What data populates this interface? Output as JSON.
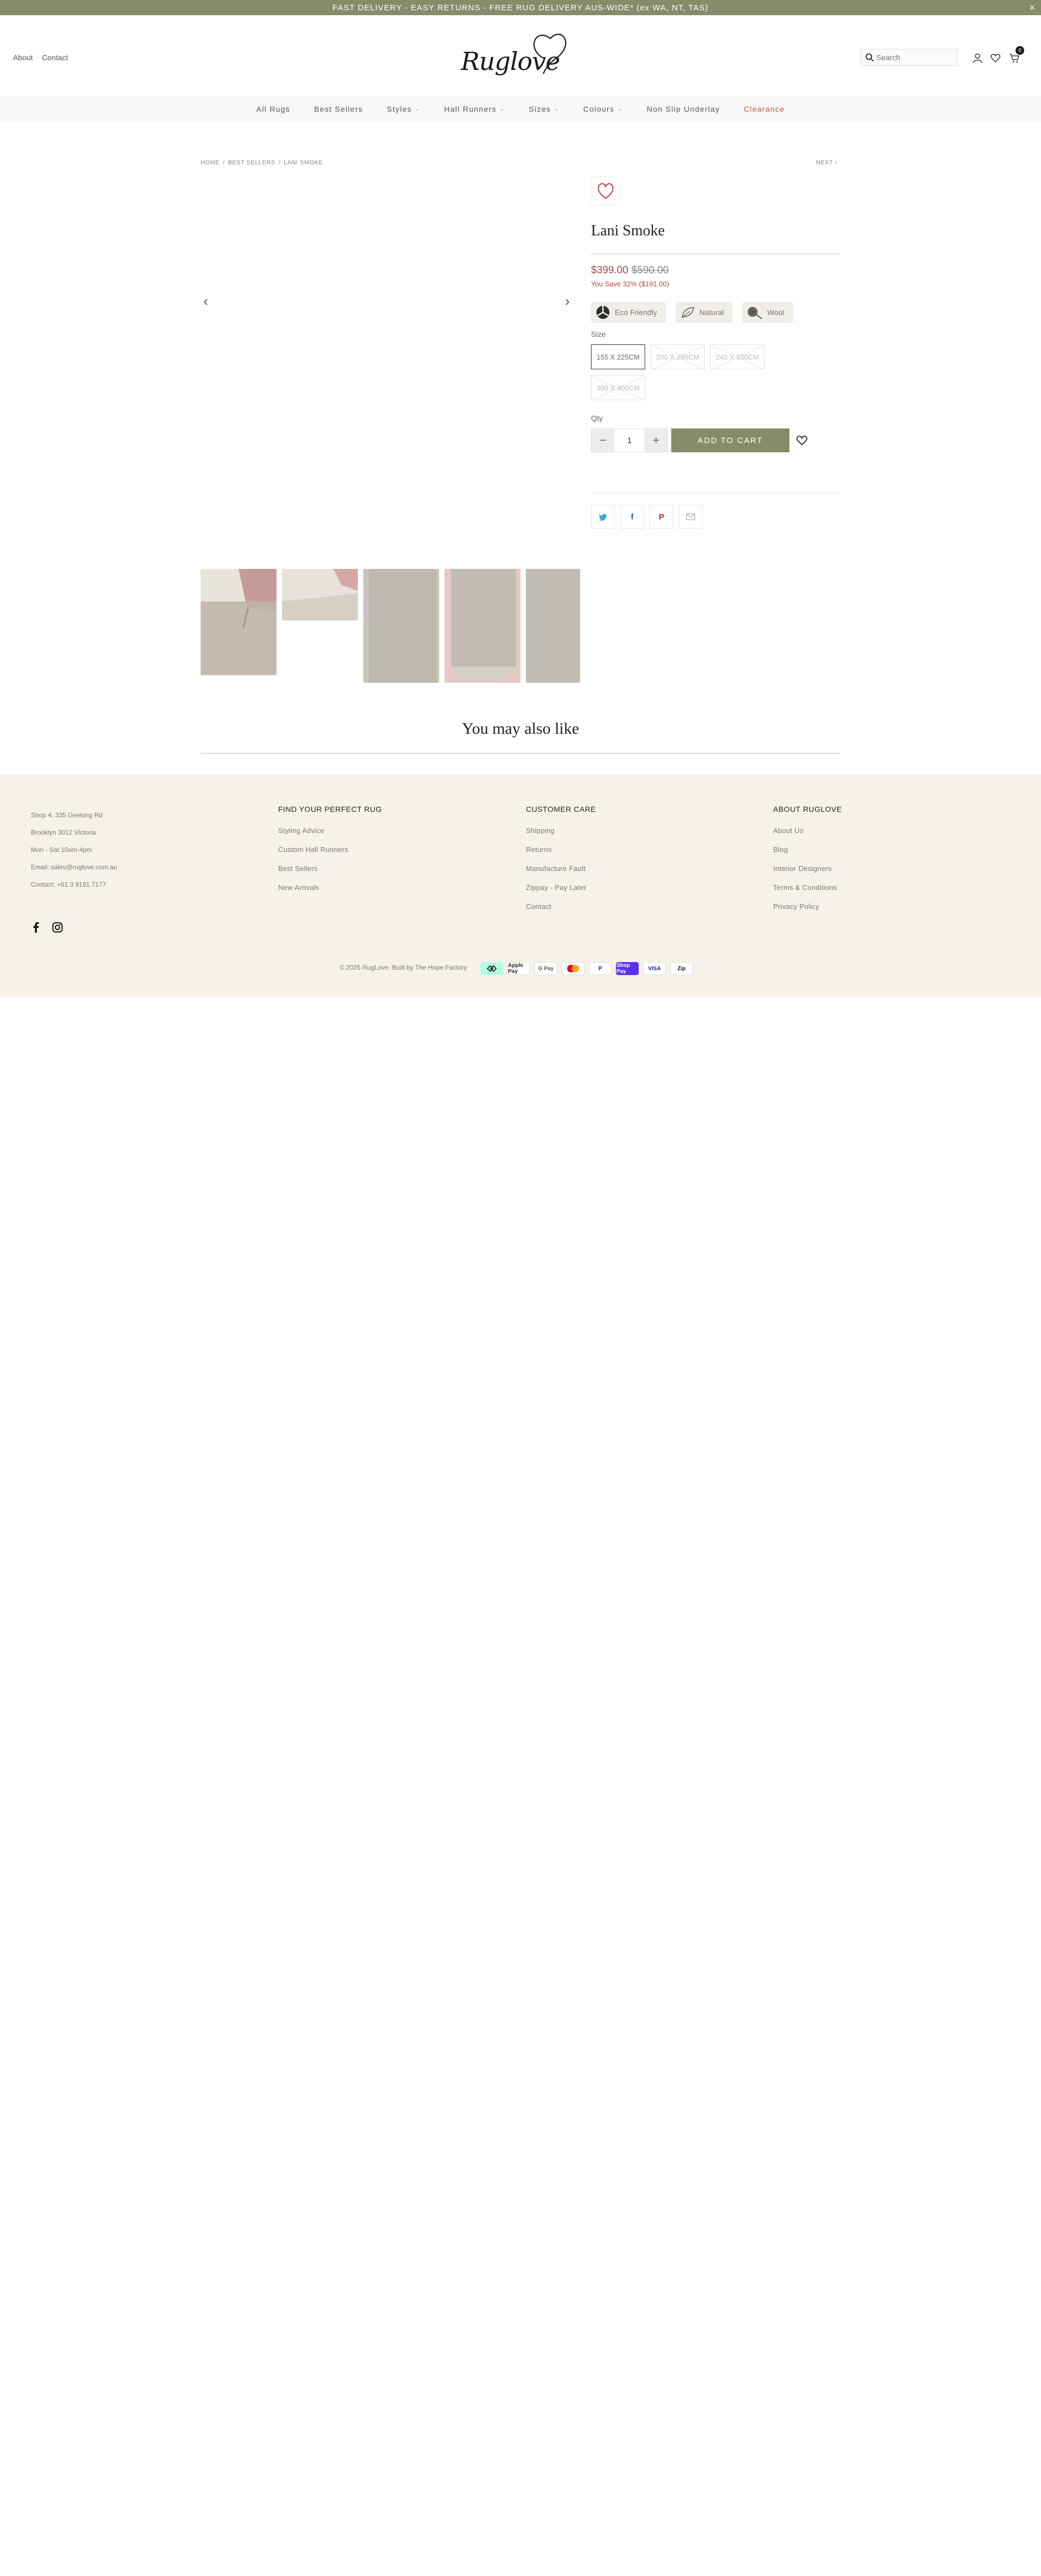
{
  "announcement": {
    "text": "FAST DELIVERY - EASY RETURNS - FREE RUG DELIVERY AUS-WIDE* (ex WA, NT, TAS)",
    "close": "×"
  },
  "header": {
    "links": [
      "About",
      "Contact"
    ],
    "logo_text": "Ruglove",
    "search_placeholder": "Search",
    "cart_count": "0"
  },
  "nav": {
    "items": [
      {
        "label": "All Rugs",
        "dropdown": false
      },
      {
        "label": "Best Sellers",
        "dropdown": false
      },
      {
        "label": "Styles",
        "dropdown": true
      },
      {
        "label": "Hall Runners",
        "dropdown": true
      },
      {
        "label": "Sizes",
        "dropdown": true
      },
      {
        "label": "Colours",
        "dropdown": true
      },
      {
        "label": "Non Slip Underlay",
        "dropdown": false
      },
      {
        "label": "Clearance",
        "dropdown": false
      }
    ]
  },
  "breadcrumb": {
    "items": [
      "HOME",
      "BEST SELLERS",
      "LANI SMOKE"
    ],
    "next": "NEXT"
  },
  "product": {
    "title": "Lani Smoke",
    "price": "$399.00",
    "was_price": "$590.00",
    "savings": "You Save 32% ($191.00)",
    "badges": [
      {
        "label": "Eco Friendly",
        "icon": "eco-icon"
      },
      {
        "label": "Natural",
        "icon": "leaf-icon"
      },
      {
        "label": "Wool",
        "icon": "wool-icon"
      }
    ],
    "size_label": "Size",
    "sizes": [
      {
        "label": "155 X 225CM",
        "available": true,
        "selected": true
      },
      {
        "label": "200 X 290CM",
        "available": false,
        "selected": false
      },
      {
        "label": "240 X 330CM",
        "available": false,
        "selected": false
      },
      {
        "label": "300 X 400CM",
        "available": false,
        "selected": false
      }
    ],
    "qty_label": "Qty",
    "qty_value": "1",
    "add_to_cart": "ADD TO CART"
  },
  "recommendations": {
    "title": "You may also like"
  },
  "footer": {
    "contact": {
      "address1": "Shop 4, 335 Geelong Rd",
      "address2": "Brooklyn 3012 Victoria",
      "hours": "Mon - Sat 10am-4pm",
      "email": "Email: sales@ruglove.com.au",
      "phone": "Contact: +61 3 9191 7177"
    },
    "columns": [
      {
        "heading": "FIND YOUR PERFECT RUG",
        "links": [
          "Styling Advice",
          "Custom Hall Runners",
          "Best Sellers",
          "New Arrivals"
        ]
      },
      {
        "heading": "CUSTOMER CARE",
        "links": [
          "Shipping",
          "Returns",
          "Manufacture Fault",
          "Zippay - Pay Later",
          "Contact"
        ]
      },
      {
        "heading": "ABOUT RUGLOVE",
        "links": [
          "About Us",
          "Blog",
          "Interior Designers",
          "Terms & Conditions",
          "Privacy Policy"
        ]
      }
    ],
    "copyright": "© 2025 RugLove. Built by The Hope Factory",
    "payments": [
      "",
      "Apple Pay",
      "G Pay",
      "",
      "P",
      "Shop Pay",
      "VISA",
      "Zip"
    ]
  },
  "colors": {
    "accent": "#858c68",
    "sale": "#b2464c",
    "footer_bg": "#f6f2ea"
  }
}
